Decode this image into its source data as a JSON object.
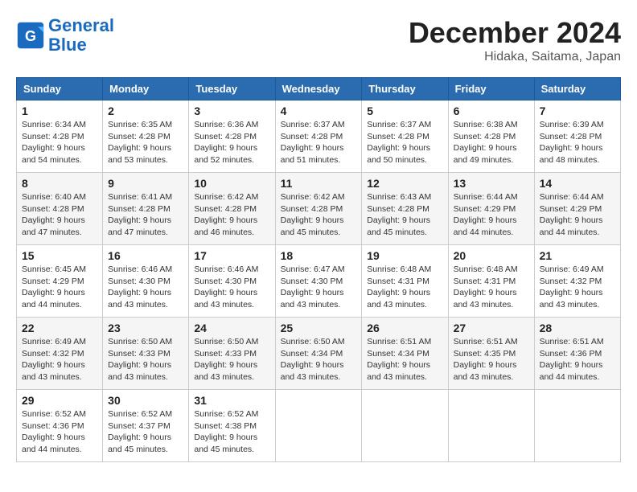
{
  "header": {
    "logo_line1": "General",
    "logo_line2": "Blue",
    "month": "December 2024",
    "location": "Hidaka, Saitama, Japan"
  },
  "days_of_week": [
    "Sunday",
    "Monday",
    "Tuesday",
    "Wednesday",
    "Thursday",
    "Friday",
    "Saturday"
  ],
  "weeks": [
    [
      {
        "day": "1",
        "sunrise": "6:34 AM",
        "sunset": "4:28 PM",
        "daylight": "9 hours and 54 minutes."
      },
      {
        "day": "2",
        "sunrise": "6:35 AM",
        "sunset": "4:28 PM",
        "daylight": "9 hours and 53 minutes."
      },
      {
        "day": "3",
        "sunrise": "6:36 AM",
        "sunset": "4:28 PM",
        "daylight": "9 hours and 52 minutes."
      },
      {
        "day": "4",
        "sunrise": "6:37 AM",
        "sunset": "4:28 PM",
        "daylight": "9 hours and 51 minutes."
      },
      {
        "day": "5",
        "sunrise": "6:37 AM",
        "sunset": "4:28 PM",
        "daylight": "9 hours and 50 minutes."
      },
      {
        "day": "6",
        "sunrise": "6:38 AM",
        "sunset": "4:28 PM",
        "daylight": "9 hours and 49 minutes."
      },
      {
        "day": "7",
        "sunrise": "6:39 AM",
        "sunset": "4:28 PM",
        "daylight": "9 hours and 48 minutes."
      }
    ],
    [
      {
        "day": "8",
        "sunrise": "6:40 AM",
        "sunset": "4:28 PM",
        "daylight": "9 hours and 47 minutes."
      },
      {
        "day": "9",
        "sunrise": "6:41 AM",
        "sunset": "4:28 PM",
        "daylight": "9 hours and 47 minutes."
      },
      {
        "day": "10",
        "sunrise": "6:42 AM",
        "sunset": "4:28 PM",
        "daylight": "9 hours and 46 minutes."
      },
      {
        "day": "11",
        "sunrise": "6:42 AM",
        "sunset": "4:28 PM",
        "daylight": "9 hours and 45 minutes."
      },
      {
        "day": "12",
        "sunrise": "6:43 AM",
        "sunset": "4:28 PM",
        "daylight": "9 hours and 45 minutes."
      },
      {
        "day": "13",
        "sunrise": "6:44 AM",
        "sunset": "4:29 PM",
        "daylight": "9 hours and 44 minutes."
      },
      {
        "day": "14",
        "sunrise": "6:44 AM",
        "sunset": "4:29 PM",
        "daylight": "9 hours and 44 minutes."
      }
    ],
    [
      {
        "day": "15",
        "sunrise": "6:45 AM",
        "sunset": "4:29 PM",
        "daylight": "9 hours and 44 minutes."
      },
      {
        "day": "16",
        "sunrise": "6:46 AM",
        "sunset": "4:30 PM",
        "daylight": "9 hours and 43 minutes."
      },
      {
        "day": "17",
        "sunrise": "6:46 AM",
        "sunset": "4:30 PM",
        "daylight": "9 hours and 43 minutes."
      },
      {
        "day": "18",
        "sunrise": "6:47 AM",
        "sunset": "4:30 PM",
        "daylight": "9 hours and 43 minutes."
      },
      {
        "day": "19",
        "sunrise": "6:48 AM",
        "sunset": "4:31 PM",
        "daylight": "9 hours and 43 minutes."
      },
      {
        "day": "20",
        "sunrise": "6:48 AM",
        "sunset": "4:31 PM",
        "daylight": "9 hours and 43 minutes."
      },
      {
        "day": "21",
        "sunrise": "6:49 AM",
        "sunset": "4:32 PM",
        "daylight": "9 hours and 43 minutes."
      }
    ],
    [
      {
        "day": "22",
        "sunrise": "6:49 AM",
        "sunset": "4:32 PM",
        "daylight": "9 hours and 43 minutes."
      },
      {
        "day": "23",
        "sunrise": "6:50 AM",
        "sunset": "4:33 PM",
        "daylight": "9 hours and 43 minutes."
      },
      {
        "day": "24",
        "sunrise": "6:50 AM",
        "sunset": "4:33 PM",
        "daylight": "9 hours and 43 minutes."
      },
      {
        "day": "25",
        "sunrise": "6:50 AM",
        "sunset": "4:34 PM",
        "daylight": "9 hours and 43 minutes."
      },
      {
        "day": "26",
        "sunrise": "6:51 AM",
        "sunset": "4:34 PM",
        "daylight": "9 hours and 43 minutes."
      },
      {
        "day": "27",
        "sunrise": "6:51 AM",
        "sunset": "4:35 PM",
        "daylight": "9 hours and 43 minutes."
      },
      {
        "day": "28",
        "sunrise": "6:51 AM",
        "sunset": "4:36 PM",
        "daylight": "9 hours and 44 minutes."
      }
    ],
    [
      {
        "day": "29",
        "sunrise": "6:52 AM",
        "sunset": "4:36 PM",
        "daylight": "9 hours and 44 minutes."
      },
      {
        "day": "30",
        "sunrise": "6:52 AM",
        "sunset": "4:37 PM",
        "daylight": "9 hours and 45 minutes."
      },
      {
        "day": "31",
        "sunrise": "6:52 AM",
        "sunset": "4:38 PM",
        "daylight": "9 hours and 45 minutes."
      },
      null,
      null,
      null,
      null
    ]
  ]
}
